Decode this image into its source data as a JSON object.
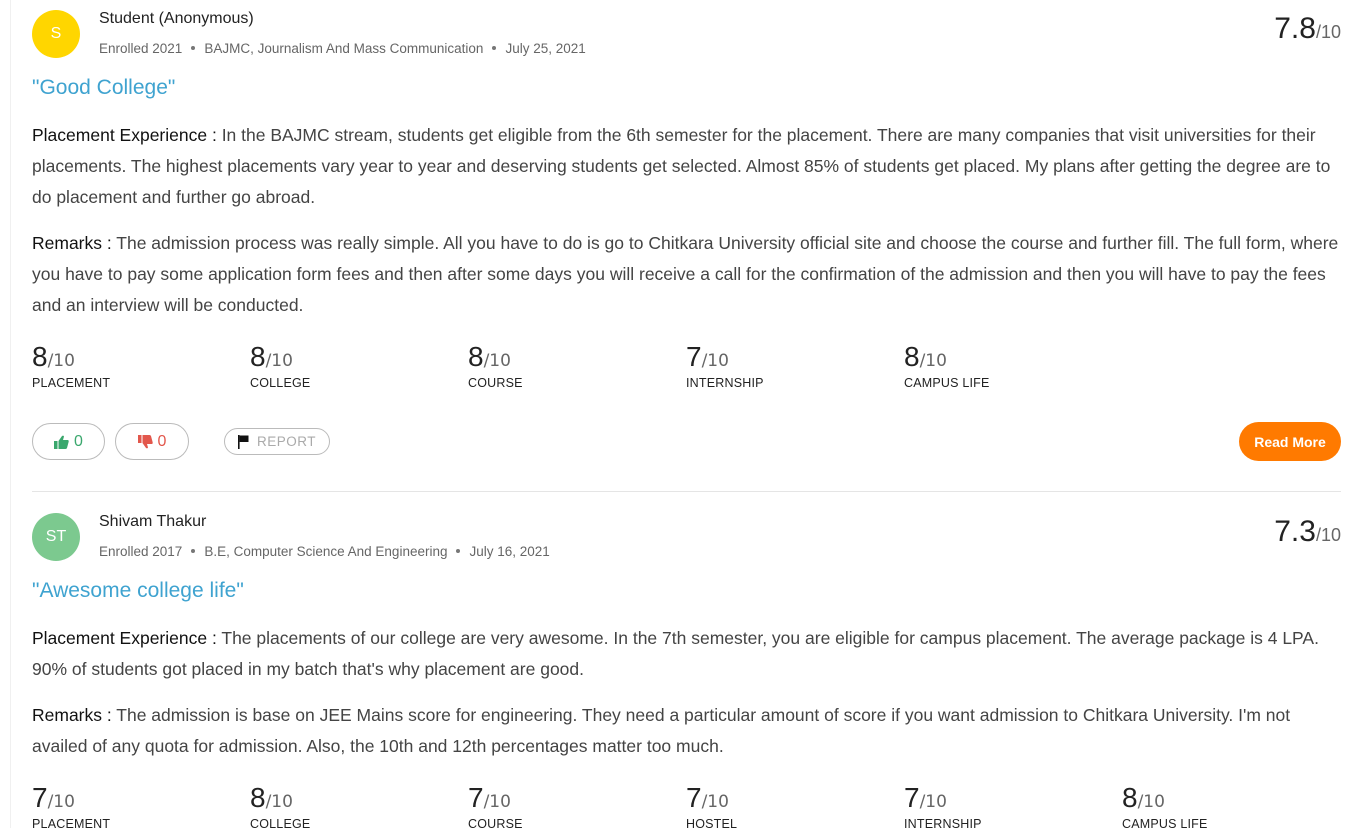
{
  "reviews": [
    {
      "avatar_initials": "S",
      "avatar_color": "#ffd600",
      "author": "Student (Anonymous)",
      "enrolled": "Enrolled 2021",
      "course": "BAJMC, Journalism And Mass Communication",
      "date": "July 25, 2021",
      "overall_score": "7.8",
      "overall_out_of": "/10",
      "title": "\"Good College\"",
      "sections": [
        {
          "label": "Placement Experience :",
          "text": " In the BAJMC stream, students get eligible from the 6th semester for the placement. There are many companies that visit universities for their placements. The highest placements vary year to year and deserving students get selected. Almost 85% of students get placed. My plans after getting the degree are to do placement and further go abroad."
        },
        {
          "label": "Remarks :",
          "text": " The admission process was really simple. All you have to do is go to Chitkara University official site and choose the course and further fill. The full form, where you have to pay some application form fees and then after some days you will receive a call for the confirmation of the admission and then you will have to pay the fees and an interview will be conducted."
        }
      ],
      "ratings": [
        {
          "score": "8",
          "out_of": "/10",
          "category": "PLACEMENT"
        },
        {
          "score": "8",
          "out_of": "/10",
          "category": "COLLEGE"
        },
        {
          "score": "8",
          "out_of": "/10",
          "category": "COURSE"
        },
        {
          "score": "7",
          "out_of": "/10",
          "category": "INTERNSHIP"
        },
        {
          "score": "8",
          "out_of": "/10",
          "category": "CAMPUS LIFE"
        }
      ],
      "upvotes": "0",
      "downvotes": "0",
      "report_label": "REPORT",
      "read_more_label": "Read More"
    },
    {
      "avatar_initials": "ST",
      "avatar_color": "#7cc98f",
      "author": "Shivam Thakur",
      "enrolled": "Enrolled 2017",
      "course": "B.E, Computer Science And Engineering",
      "date": "July 16, 2021",
      "overall_score": "7.3",
      "overall_out_of": "/10",
      "title": "\"Awesome college life\"",
      "sections": [
        {
          "label": "Placement Experience :",
          "text": " The placements of our college are very awesome. In the 7th semester, you are eligible for campus placement. The average package is 4 LPA. 90% of students got placed in my batch that's why placement are good."
        },
        {
          "label": "Remarks :",
          "text": " The admission is base on JEE Mains score for engineering. They need a particular amount of score if you want admission to Chitkara University. I'm not availed of any quota for admission. Also, the 10th and 12th percentages matter too much."
        }
      ],
      "ratings": [
        {
          "score": "7",
          "out_of": "/10",
          "category": "PLACEMENT"
        },
        {
          "score": "8",
          "out_of": "/10",
          "category": "COLLEGE"
        },
        {
          "score": "7",
          "out_of": "/10",
          "category": "COURSE"
        },
        {
          "score": "7",
          "out_of": "/10",
          "category": "HOSTEL"
        },
        {
          "score": "7",
          "out_of": "/10",
          "category": "INTERNSHIP"
        },
        {
          "score": "8",
          "out_of": "/10",
          "category": "CAMPUS LIFE"
        }
      ]
    }
  ],
  "icons": {
    "upvote": "thumbs-up-icon",
    "downvote": "thumbs-down-icon",
    "report": "flag-icon"
  }
}
